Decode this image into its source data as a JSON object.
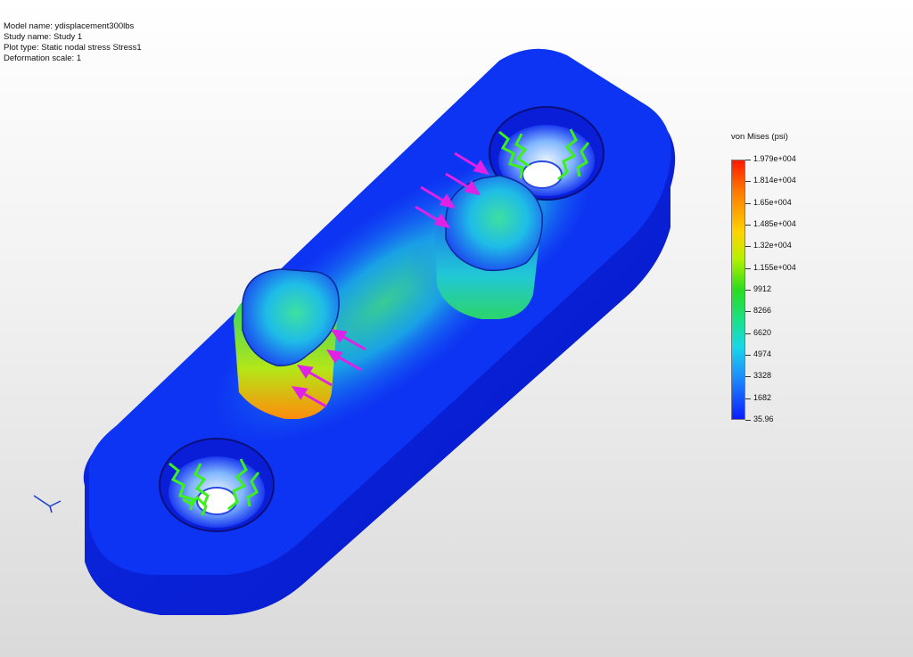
{
  "study_info": {
    "model_name": "Model name: ydisplacement300lbs",
    "study_name": "Study name: Study 1",
    "plot_type": "Plot type: Static nodal stress Stress1",
    "deformation_scale": "Deformation scale: 1"
  },
  "legend": {
    "title": "von Mises (psi)",
    "labels": [
      "1.979e+004",
      "1.814e+004",
      "1.65e+004",
      "1.485e+004",
      "1.32e+004",
      "1.155e+004",
      "9912",
      "8266",
      "6620",
      "4974",
      "3328",
      "1682",
      "35.96"
    ]
  },
  "colors": {
    "stress_low": "#0a1eff",
    "stress_mid": "#2ddc1e",
    "stress_high": "#ff1a00",
    "load_arrow": "#e021e6",
    "fixture_marker": "#3cf01c"
  },
  "icons": {
    "orientation_triad": "axis-triad-icon"
  }
}
